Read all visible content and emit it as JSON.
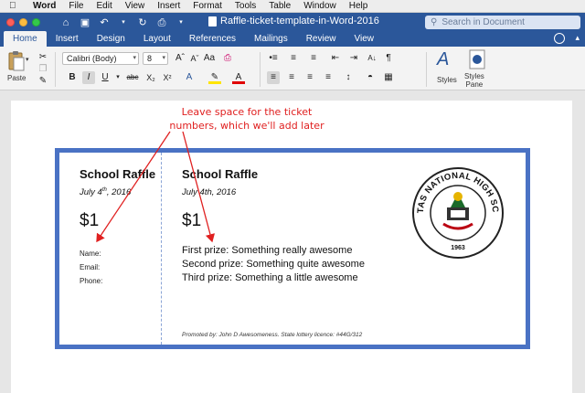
{
  "menubar": {
    "app": "Word",
    "items": [
      "File",
      "Edit",
      "View",
      "Insert",
      "Format",
      "Tools",
      "Table",
      "Window",
      "Help"
    ]
  },
  "titlebar": {
    "document_title": "Raffle-ticket-template-in-Word-2016",
    "search_placeholder": "Search in Document"
  },
  "ribbon": {
    "tabs": [
      "Home",
      "Insert",
      "Design",
      "Layout",
      "References",
      "Mailings",
      "Review",
      "View"
    ],
    "active_tab": "Home",
    "paste_label": "Paste",
    "font_name": "Calibri (Body)",
    "font_size": "8",
    "styles_label": "Styles",
    "styles_pane_label": "Styles\nPane"
  },
  "annotation": {
    "text_line1": "Leave space for the ticket",
    "text_line2": "numbers, which we'll add later"
  },
  "ticket": {
    "stub": {
      "title": "School Raffle",
      "date_pre": "July 4",
      "date_sup": "th",
      "date_post": ", 2016",
      "price": "$1",
      "name_label": "Name:",
      "email_label": "Email:",
      "phone_label": "Phone:"
    },
    "main": {
      "title": "School Raffle",
      "date": "July 4th, 2016",
      "price": "$1",
      "prize1": "First prize: Something really awesome",
      "prize2": "Second prize: Something quite awesome",
      "prize3": "Third prize: Something a little awesome",
      "footer": "Promoted by: John D Awesomeness. State lottery licence: #44G/312"
    },
    "logo": {
      "text": "NAVOTAS NATIONAL HIGH SCHOOL",
      "year": "1963"
    }
  },
  "colors": {
    "word_blue": "#2b579a",
    "ticket_border": "#4a72c4",
    "annotation_red": "#e02020"
  }
}
